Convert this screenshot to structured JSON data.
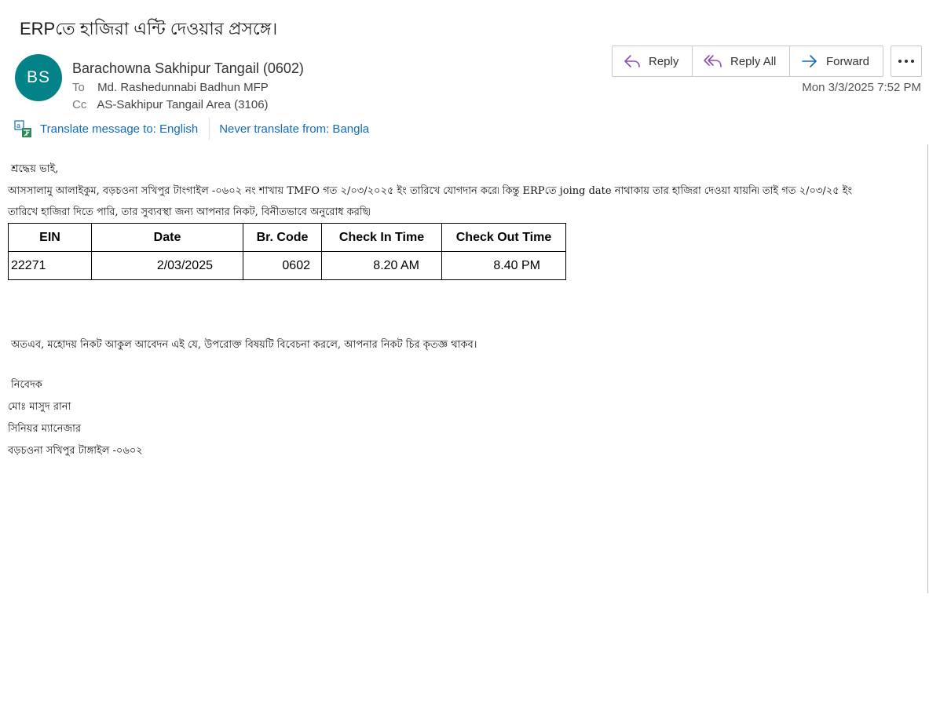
{
  "email": {
    "subject": "ERPতে হাজিরা এন্টি দেওয়ার প্রসঙ্গে।",
    "avatar_initials": "BS",
    "avatar_color": "#038387",
    "sender": "Barachowna Sakhipur Tangail (0602)",
    "to_label": "To",
    "to": "Md. Rashedunnabi Badhun MFP",
    "cc_label": "Cc",
    "cc": "AS-Sakhipur Tangail Area (3106)",
    "date": "Mon 3/3/2025 7:52 PM"
  },
  "actions": {
    "reply": "Reply",
    "reply_all": "Reply All",
    "forward": "Forward",
    "icon_color": "#8a4fae",
    "forward_icon_color": "#0f6cbd"
  },
  "translate": {
    "translate_link": "Translate message to: English",
    "never_link": "Never translate from: Bangla",
    "link_color": "#0f6cbd"
  },
  "body": {
    "greeting": "শ্রদ্ধেয় ভাই,",
    "para_line1": "আসসালামু আলাইকুম, বড়চওনা সখিপুর টাংগাইল -০৬০২ নং শাখায় TMFO গত ২/০৩/২০২৫ ইং তারিখে যোগদান করে৷ কিন্তু ERPতে joing date নাথাকায় তার হাজিরা দেওয়া যায়নি৷ তাই গত ২/০৩/২৫ ইং",
    "para_line2": "তারিখে  হাজিরা দিতে পারি, তার সুব্যবস্থা জন্য আপনার নিকট,  বিনীতভাবে অনুরোধ করছি৷",
    "table": {
      "headers": [
        "EIN",
        "Date",
        "Br. Code",
        "Check In Time",
        "Check Out Time"
      ],
      "rows": [
        [
          "22271",
          "2/03/2025",
          "0602",
          "8.20 AM",
          "8.40 PM"
        ]
      ]
    },
    "closing": "অতএব, মহোদয় নিকট আকুল আবেদন এই যে, উপরোক্ত বিষয়টি বিবেচনা করলে, আপনার নিকট চির কৃতজ্ঞ থাকব।",
    "signature": {
      "line1": "নিবেদক",
      "line2": "মোঃ মাসুদ রানা",
      "line3": "সিনিয়র ম্যানেজার",
      "line4": "বড়চওনা সখিপুর টাঙ্গাইল -০৬০২"
    }
  }
}
